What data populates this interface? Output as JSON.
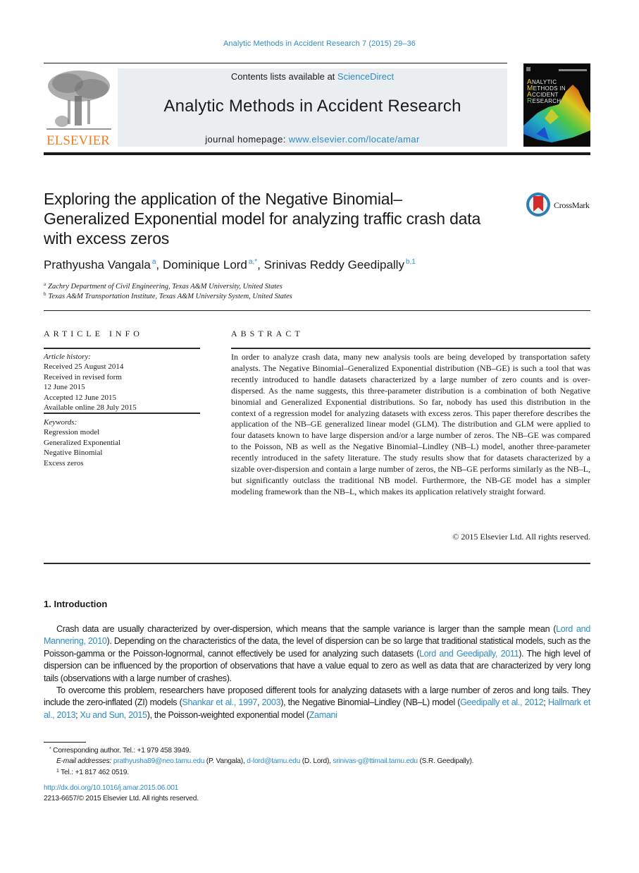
{
  "running_head": "Analytic Methods in Accident Research  7 (2015) 29–36",
  "masthead": {
    "publisher_logo_text": "ELSEVIER",
    "contents_prefix": "Contents lists available at ",
    "contents_link": "ScienceDirect",
    "journal_title": "Analytic Methods in Accident Research",
    "homepage_prefix": "journal homepage: ",
    "homepage_link": "www.elsevier.com/locate/amar",
    "cover": {
      "lines": [
        {
          "cap": "A",
          "rest": "NALYTIC"
        },
        {
          "cap": "M",
          "rest": "ETHODS IN"
        },
        {
          "cap": "A",
          "rest": "CCIDENT"
        },
        {
          "cap": "R",
          "rest": "ESEARCH"
        }
      ]
    }
  },
  "article": {
    "title_lines": [
      "Exploring the application of the Negative Binomial–",
      "Generalized Exponential model for analyzing traffic crash data",
      "with excess zeros"
    ],
    "crossmark_label": "CrossMark",
    "authors": [
      {
        "name": "Prathyusha Vangala",
        "sup": "a"
      },
      {
        "name": "Dominique Lord",
        "sup": "a,*"
      },
      {
        "name": "Srinivas Reddy Geedipally",
        "sup": "b,1"
      }
    ],
    "affiliations": [
      {
        "mark": "a",
        "text": "Zachry Department of Civil Engineering, Texas A&M University, United States"
      },
      {
        "mark": "b",
        "text": "Texas A&M Transportation Institute, Texas A&M University System, United States"
      }
    ]
  },
  "article_info": {
    "heading": "ARTICLE INFO",
    "history_label": "Article history:",
    "history": [
      "Received 25 August 2014",
      "Received in revised form",
      "12 June 2015",
      "Accepted 12 June 2015",
      "Available online 28 July 2015"
    ],
    "keywords_label": "Keywords:",
    "keywords": [
      "Regression model",
      "Generalized Exponential",
      "Negative Binomial",
      "Excess zeros"
    ]
  },
  "abstract": {
    "heading": "ABSTRACT",
    "text": "In order to analyze crash data, many new analysis tools are being developed by transportation safety analysts. The Negative Binomial–Generalized Exponential distribution (NB–GE) is such a tool that was recently introduced to handle datasets characterized by a large number of zero counts and is over-dispersed. As the name suggests, this three-parameter distribution is a combination of both Negative binomial and Generalized Exponential distributions. So far, nobody has used this distribution in the context of a regression model for analyzing datasets with excess zeros. This paper therefore describes the application of the NB–GE generalized linear model (GLM). The distribution and GLM were applied to four datasets known to have large dispersion and/or a large number of zeros. The NB–GE was compared to the Poisson, NB as well as the Negative Binomial–Lindley (NB–L) model, another three-parameter recently introduced in the safety literature. The study results show that for datasets characterized by a sizable over-dispersion and contain a large number of zeros, the NB–GE performs similarly as the NB–L, but significantly outclass the traditional NB model. Furthermore, the NB-GE model has a simpler modeling framework than the NB–L, which makes its application relatively straight forward.",
    "copyright": "© 2015 Elsevier Ltd. All rights reserved."
  },
  "introduction": {
    "heading": "1.  Introduction",
    "p1": {
      "t1": "Crash data are usually characterized by over-dispersion, which means that the sample variance is larger than the sample mean (",
      "c1": "Lord and Mannering, 2010",
      "t2": "). Depending on the characteristics of the data, the level of dispersion can be so large that traditional statistical models, such as the Poisson-gamma or the Poisson-lognormal, cannot effectively be used for analyzing such datasets (",
      "c2": "Lord and Geedipally, 2011",
      "t3": "). The high level of dispersion can be influenced by the proportion of observations that have a value equal to zero as well as data that are characterized by very long tails (observations with a large number of crashes)."
    },
    "p2": {
      "t1": "To overcome this problem, researchers have proposed different tools for analyzing datasets with a large number of zeros and long tails. They include the zero-inflated (ZI) models (",
      "c1": "Shankar et al., 1997",
      "t2": ", ",
      "c2": "2003",
      "t3": "), the Negative Binomial–Lindley (NB–L) model (",
      "c3": "Geedipally et al., 2012",
      "t4": "; ",
      "c4": "Hallmark et al., 2013",
      "t5": "; ",
      "c5": "Xu and Sun, 2015",
      "t6": "), the Poisson-weighted exponential model (",
      "c6": "Zamani"
    }
  },
  "footnotes": {
    "corresponding": "Corresponding author. Tel.: +1 979 458 3949.",
    "corresponding_mark": "*",
    "email_label": "E-mail addresses:",
    "emails": [
      {
        "address": "prathyusha89@neo.tamu.edu",
        "who": " (P. Vangala), "
      },
      {
        "address": "d-lord@tamu.edu",
        "who": " (D. Lord), "
      },
      {
        "address": "srinivas-g@ttimail.tamu.edu",
        "who": " (S.R. Geedipally)."
      }
    ],
    "fn1_mark": "1",
    "fn1": "Tel.: +1 817 462 0519.",
    "doi": "http://dx.doi.org/10.1016/j.amar.2015.06.001",
    "issn": "2213-6657/© 2015 Elsevier Ltd. All rights reserved."
  },
  "colors": {
    "link": "#2e8bc7",
    "elsevier_orange": "#f07f22",
    "masthead_bg": "#ebeef0"
  }
}
